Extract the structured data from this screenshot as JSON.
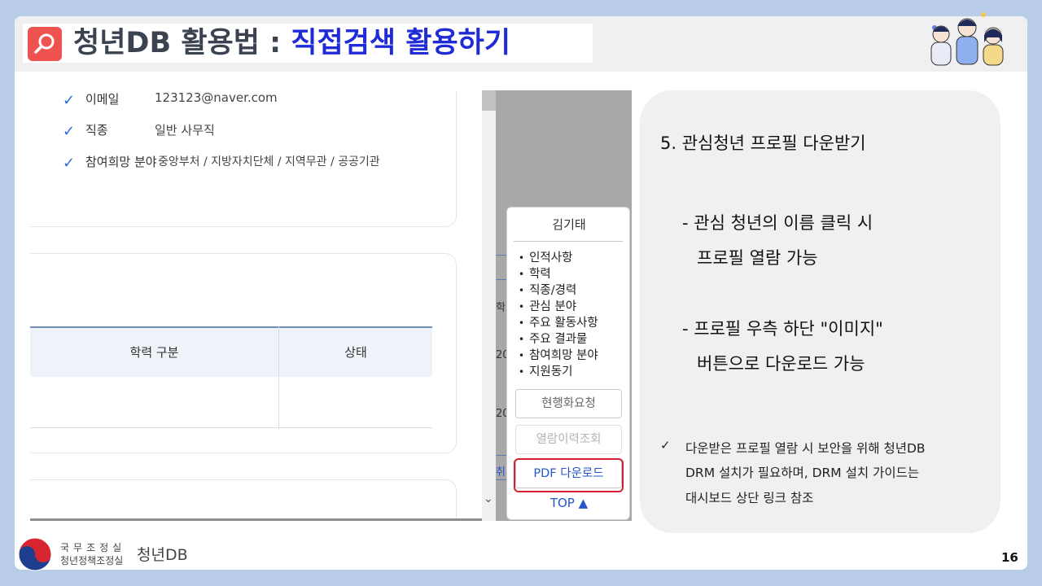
{
  "header": {
    "title_part1": "청년DB 활용법 :",
    "title_part2": "직접검색 활용하기"
  },
  "screenshot": {
    "info_rows": [
      {
        "label": "이메일",
        "value": "123123@naver.com"
      },
      {
        "label": "직종",
        "value": "일반 사무직"
      },
      {
        "label": "참여희망 분야",
        "value": "중앙부처 / 지방자치단체 / 지역무관 / 공공기관"
      }
    ],
    "table_headers": [
      "학력 구분",
      "상태"
    ],
    "edge_texts": [
      "학",
      "20",
      "20",
      "취"
    ],
    "popup": {
      "name": "김기태",
      "items": [
        "인적사항",
        "학력",
        "직종/경력",
        "관심 분야",
        "주요 활동사항",
        "주요 결과물",
        "참여희망 분야",
        "지원동기"
      ],
      "buttons": {
        "action_request": "현행화요청",
        "view_history": "열람이력조회",
        "pdf_download": "PDF 다운로드"
      },
      "top_label": "TOP ▲"
    }
  },
  "explanation": {
    "step_title": "5.  관심청년 프로필 다운받기",
    "desc1_line1": "- 관심 청년의 이름 클릭 시",
    "desc1_line2": "프로필 열람 가능",
    "desc2_line1": "- 프로필 우측 하단 \"이미지\"",
    "desc2_line2": "버튼으로 다운로드 가능",
    "note_mark": "✓",
    "note_line1": "다운받은 프로필 열람 시 보안을 위해 청년DB",
    "note_line2": "DRM 설치가 필요하며, DRM 설치 가이드는",
    "note_line3": "대시보드 상단 링크 참조"
  },
  "footer": {
    "org_line1": "국무조정실",
    "org_line2": "청년정책조정실",
    "brand": "청년DB",
    "page_number": "16"
  },
  "icons": {
    "title_icon": "search-icon",
    "footer_logo": "taegeuk-emblem-icon",
    "check": "check-icon"
  },
  "colors": {
    "accent_blue": "#1f2bd6",
    "highlight_red": "#d1202e",
    "link_blue": "#2456c7"
  }
}
